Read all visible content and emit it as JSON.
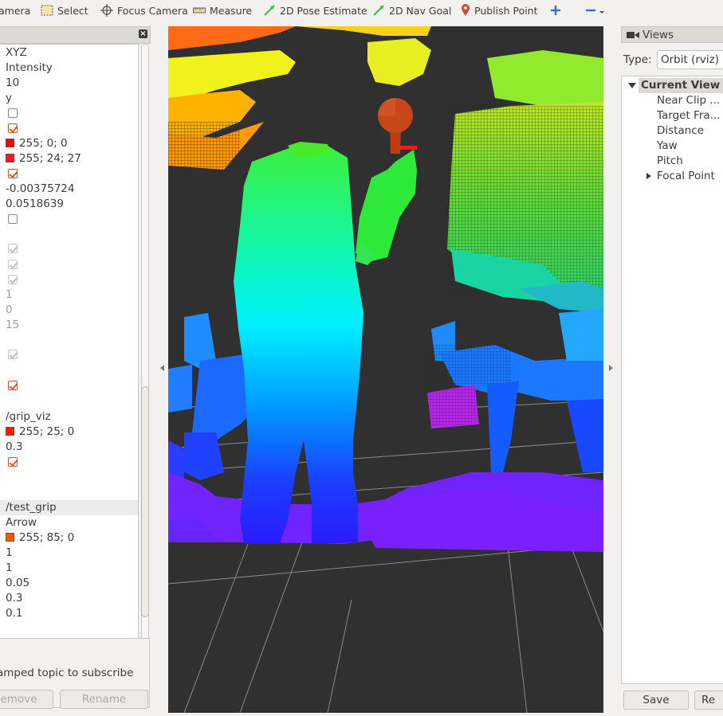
{
  "toolbar": {
    "interact_label": "amera",
    "select_label": "Select",
    "focus_camera_label": "Focus Camera",
    "measure_label": "Measure",
    "pose_estimate_label": "2D Pose Estimate",
    "nav_goal_label": "2D Nav Goal",
    "publish_point_label": "Publish Point"
  },
  "left_panel": {
    "rows": [
      "XYZ",
      "Intensity",
      "10",
      "y"
    ],
    "color_a": "255; 0; 0",
    "color_b": "255; 24; 27",
    "value_min": "-0.00375724",
    "value_max": "0.0518639",
    "gray_values": [
      "1",
      "0",
      "15"
    ],
    "grip_viz_label": "/grip_viz",
    "grip_viz_color": "255; 25; 0",
    "grip_viz_alpha": "0.3",
    "test_grip_label": "/test_grip",
    "test_grip_shape": "Arrow",
    "test_grip_color": "255; 85; 0",
    "test_grip_values": [
      "1",
      "1",
      "0.05",
      "0.3",
      "0.1"
    ],
    "description": "amped topic to subscribe",
    "remove_label": "emove",
    "rename_label": "Rename"
  },
  "colors": {
    "swatch_red": "#ff0000",
    "swatch_red2": "#ff181b",
    "swatch_grip": "#ff1900",
    "swatch_arrow": "#ff5500",
    "viewport_bg": "#303030",
    "accent_check": "#d8582a"
  },
  "views_panel": {
    "title": "Views",
    "type_label": "Type:",
    "type_value": "Orbit (rviz)",
    "current_view": "Current View",
    "items": [
      "Near Clip ...",
      "Target Fra...",
      "Distance",
      "Yaw",
      "Pitch",
      "Focal Point"
    ],
    "save_label": "Save",
    "reset_label": "Re"
  },
  "icons": [
    "select-icon",
    "focus-camera-icon",
    "measure-icon",
    "pose-estimate-icon",
    "nav-goal-icon",
    "publish-point-icon",
    "add-tool-icon",
    "remove-tool-icon",
    "close-icon",
    "camera-icon"
  ]
}
